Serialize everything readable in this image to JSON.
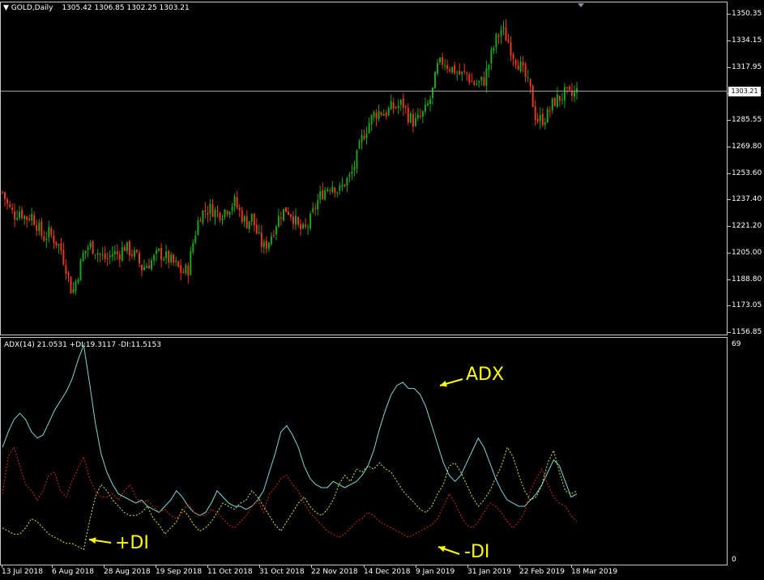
{
  "chart_header": {
    "symbol": "GOLD,Daily",
    "ohlc": "1305.42 1306.85 1302.25 1303.21"
  },
  "current_price": "1303.21",
  "price_scale": [
    "1350.35",
    "1334.15",
    "1317.95",
    "1301.75",
    "1285.55",
    "1269.80",
    "1253.60",
    "1237.40",
    "1221.20",
    "1205.00",
    "1188.80",
    "1173.05",
    "1156.85"
  ],
  "indicator_header": "ADX(14) 21.0531 +DI:19.3117 -DI:11.5153",
  "indicator_scale": {
    "top": "69",
    "bottom": "0"
  },
  "x_axis_labels": [
    "13 Jul 2018",
    "6 Aug 2018",
    "28 Aug 2018",
    "19 Sep 2018",
    "11 Oct 2018",
    "31 Oct 2018",
    "22 Nov 2018",
    "14 Dec 2018",
    "9 Jan 2019",
    "31 Jan 2019",
    "22 Feb 2019",
    "18 Mar 2019"
  ],
  "annotations": {
    "adx": "ADX",
    "plus_di": "+DI",
    "minus_di": "-DI"
  },
  "colors": {
    "background": "#000000",
    "bull_candle": "#1aa51a",
    "bear_candle": "#e8371a",
    "adx_line": "#7fd6d6",
    "plus_di_line": "#c8f03c",
    "minus_di_line": "#d22a1a",
    "annotation": "#ffff00",
    "grid_line": "#c8c8c8"
  },
  "chart_data": [
    {
      "type": "candlestick",
      "title": "GOLD,Daily",
      "ylim": [
        1156.85,
        1350.35
      ],
      "close_path": [
        1242,
        1233,
        1228,
        1231,
        1226,
        1228,
        1222,
        1214,
        1217,
        1213,
        1208,
        1196,
        1180,
        1192,
        1205,
        1210,
        1207,
        1203,
        1201,
        1205,
        1204,
        1209,
        1206,
        1203,
        1196,
        1198,
        1201,
        1205,
        1203,
        1200,
        1197,
        1193,
        1195,
        1214,
        1228,
        1231,
        1232,
        1229,
        1230,
        1233,
        1236,
        1229,
        1223,
        1227,
        1215,
        1208,
        1213,
        1222,
        1229,
        1232,
        1228,
        1220,
        1218,
        1224,
        1234,
        1241,
        1245,
        1247,
        1242,
        1248,
        1251,
        1262,
        1275,
        1283,
        1289,
        1291,
        1290,
        1293,
        1294,
        1296,
        1288,
        1284,
        1287,
        1292,
        1301,
        1318,
        1322,
        1318,
        1316,
        1313,
        1314,
        1308,
        1308,
        1310,
        1322,
        1334,
        1341,
        1335,
        1326,
        1320,
        1313,
        1303,
        1286,
        1286,
        1289,
        1297,
        1299,
        1302,
        1300,
        1303
      ]
    },
    {
      "type": "line",
      "title": "ADX(14) 21.0531 +DI:19.3117 -DI:11.5153",
      "ylim": [
        0,
        69
      ],
      "series": [
        {
          "name": "ADX",
          "values": [
            36,
            41,
            45,
            47,
            45,
            41,
            39,
            40,
            44,
            48,
            51,
            54,
            58,
            64,
            69,
            57,
            44,
            34,
            28,
            24,
            21,
            20,
            19,
            18,
            19,
            17,
            16,
            15,
            17,
            19,
            22,
            20,
            17,
            15,
            14,
            15,
            18,
            22,
            20,
            18,
            17,
            17,
            16,
            17,
            19,
            22,
            28,
            34,
            41,
            43,
            40,
            36,
            30,
            26,
            24,
            23,
            23,
            25,
            24,
            23,
            24,
            25,
            27,
            30,
            35,
            42,
            48,
            53,
            56,
            57,
            55,
            55,
            53,
            49,
            43,
            37,
            31,
            27,
            25,
            27,
            31,
            35,
            39,
            36,
            31,
            26,
            22,
            19,
            18,
            17,
            17,
            19,
            21,
            24,
            28,
            32,
            30,
            25,
            20,
            21
          ]
        },
        {
          "name": "+DI",
          "values": [
            10,
            9,
            8,
            8,
            10,
            13,
            12,
            10,
            8,
            7,
            6,
            5,
            5,
            4,
            3,
            12,
            20,
            24,
            22,
            19,
            17,
            15,
            14,
            14,
            15,
            17,
            13,
            11,
            8,
            10,
            12,
            16,
            14,
            11,
            9,
            10,
            12,
            15,
            18,
            17,
            16,
            18,
            19,
            22,
            20,
            17,
            14,
            11,
            9,
            12,
            15,
            18,
            20,
            17,
            15,
            14,
            16,
            19,
            24,
            27,
            25,
            29,
            28,
            30,
            29,
            31,
            29,
            28,
            25,
            22,
            20,
            18,
            16,
            15,
            17,
            21,
            24,
            30,
            31,
            28,
            24,
            20,
            17,
            19,
            22,
            26,
            30,
            36,
            33,
            27,
            22,
            19,
            20,
            24,
            31,
            35,
            28,
            22,
            21,
            22
          ]
        },
        {
          "name": "-DI",
          "values": [
            21,
            33,
            36,
            30,
            24,
            22,
            19,
            22,
            27,
            28,
            22,
            20,
            25,
            29,
            33,
            26,
            22,
            20,
            20,
            21,
            19,
            22,
            24,
            20,
            18,
            19,
            17,
            15,
            16,
            14,
            13,
            15,
            18,
            15,
            14,
            14,
            16,
            15,
            13,
            11,
            10,
            12,
            14,
            17,
            19,
            15,
            21,
            23,
            26,
            27,
            24,
            22,
            18,
            15,
            13,
            11,
            9,
            8,
            7,
            8,
            10,
            12,
            13,
            15,
            14,
            12,
            11,
            10,
            9,
            8,
            7,
            8,
            9,
            10,
            11,
            13,
            17,
            21,
            18,
            14,
            11,
            10,
            12,
            15,
            18,
            17,
            15,
            12,
            10,
            12,
            15,
            22,
            26,
            29,
            24,
            20,
            18,
            17,
            14,
            12
          ]
        }
      ]
    }
  ]
}
